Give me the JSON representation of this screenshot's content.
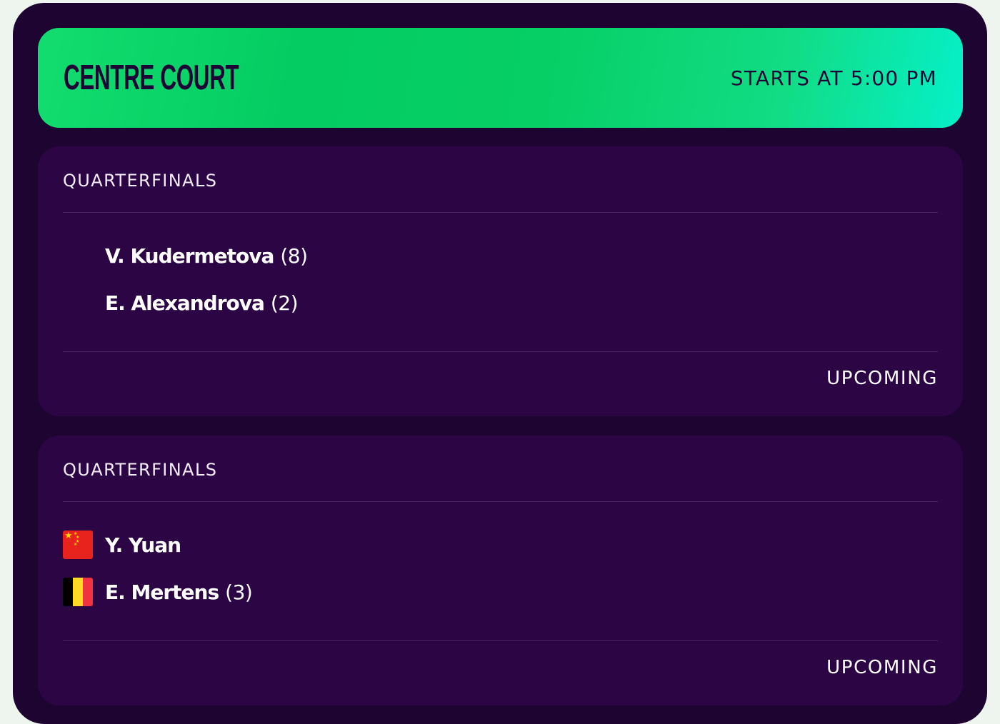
{
  "court": {
    "name": "CENTRE COURT",
    "start_time": "STARTS AT 5:00 PM"
  },
  "matches": [
    {
      "round": "QUARTERFINALS",
      "players": [
        {
          "name": "V. Kudermetova",
          "seed": "(8)",
          "flag": ""
        },
        {
          "name": "E. Alexandrova",
          "seed": "(2)",
          "flag": ""
        }
      ],
      "status": "UPCOMING"
    },
    {
      "round": "QUARTERFINALS",
      "players": [
        {
          "name": "Y. Yuan",
          "seed": "",
          "flag": "china-flag-icon"
        },
        {
          "name": "E. Mertens",
          "seed": "(3)",
          "flag": "belgium-flag-icon"
        }
      ],
      "status": "UPCOMING"
    }
  ],
  "colors": {
    "header_accent": "#06cf66",
    "panel_background": "#1e0430",
    "card_background": "#2c0545",
    "text_dark": "#1e0436"
  }
}
